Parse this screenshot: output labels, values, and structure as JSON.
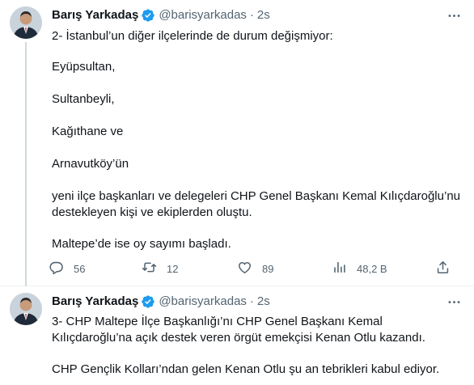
{
  "tweets": [
    {
      "author": {
        "name": "Barış Yarkadaş",
        "handle": "@barisyarkadas",
        "separator": "·",
        "time": "2s"
      },
      "lines": [
        "2- İstanbul’un diğer ilçelerinde de durum değişmiyor:",
        "Eyüpsultan,",
        "Sultanbeyli,",
        "Kağıthane ve",
        "Arnavutköy’ün",
        "yeni ilçe başkanları ve delegeleri CHP Genel Başkanı Kemal Kılıçdaroğlu’nu",
        "destekleyen kişi ve ekiplerden oluştu.",
        "Maltepe’de ise oy sayımı başladı."
      ],
      "stats": {
        "replies": "56",
        "retweets": "12",
        "likes": "89",
        "views": "48,2 B"
      }
    },
    {
      "author": {
        "name": "Barış Yarkadaş",
        "handle": "@barisyarkadas",
        "separator": "·",
        "time": "2s"
      },
      "lines": [
        "3- CHP Maltepe İlçe Başkanlığı’nı CHP Genel Başkanı Kemal",
        "Kılıçdaroğlu’na açık destek veren örgüt emekçisi Kenan Otlu kazandı.",
        "CHP Gençlik Kolları’ndan gelen Kenan Otlu şu an tebrikleri kabul ediyor."
      ]
    }
  ],
  "icons": {
    "verified": "verified-badge-icon",
    "more": "more-options-icon",
    "reply": "reply-icon",
    "retweet": "retweet-icon",
    "like": "like-icon",
    "views": "views-icon",
    "share": "share-icon"
  },
  "colors": {
    "verified": "#1d9bf0",
    "text": "#0f1419",
    "muted": "#536471",
    "divider": "#eff3f4"
  }
}
